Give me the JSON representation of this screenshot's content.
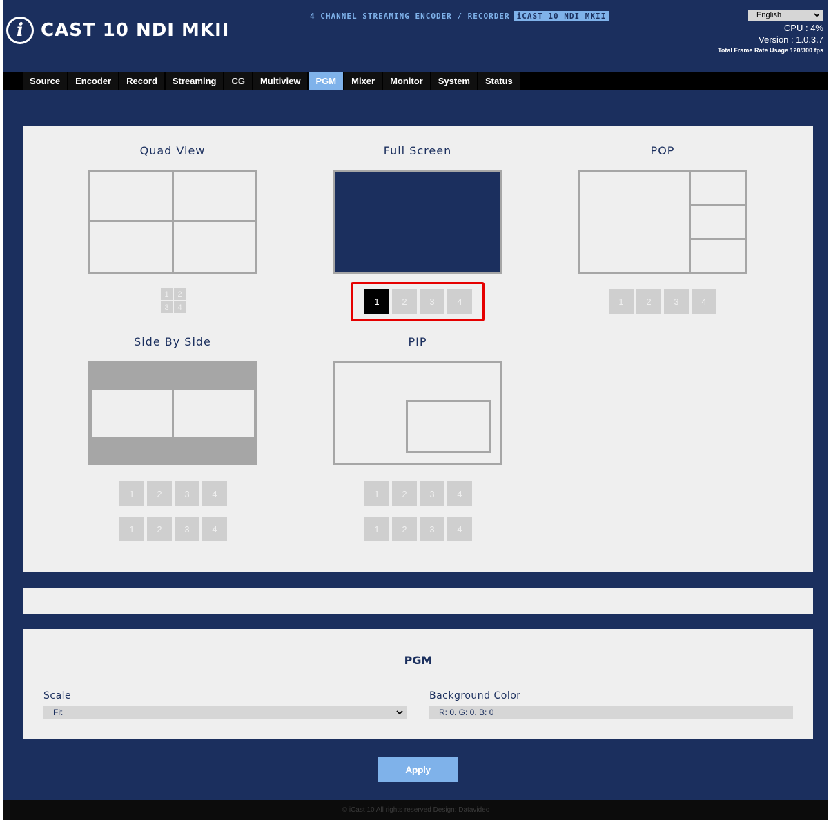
{
  "header": {
    "logo_letter": "i",
    "logo_text": "CAST 10 NDI MKII",
    "subtitle": "4 CHANNEL STREAMING ENCODER / RECORDER",
    "badge": "iCAST 10 NDI MKII",
    "language": "English",
    "cpu": "CPU : 4%",
    "version": "Version : 1.0.3.7",
    "frame_rate": "Total Frame Rate Usage 120/300 fps"
  },
  "nav": {
    "items": [
      "Source",
      "Encoder",
      "Record",
      "Streaming",
      "CG",
      "Multiview",
      "PGM",
      "Mixer",
      "Monitor",
      "System",
      "Status"
    ],
    "active": "PGM"
  },
  "layouts": {
    "quad_view": {
      "title": "Quad View",
      "mini": [
        "1",
        "2",
        "3",
        "4"
      ]
    },
    "full_screen": {
      "title": "Full Screen",
      "buttons": [
        "1",
        "2",
        "3",
        "4"
      ],
      "selected": "1"
    },
    "pop": {
      "title": "POP",
      "buttons": [
        "1",
        "2",
        "3",
        "4"
      ]
    },
    "side_by_side": {
      "title": "Side By Side",
      "row1": [
        "1",
        "2",
        "3",
        "4"
      ],
      "row2": [
        "1",
        "2",
        "3",
        "4"
      ]
    },
    "pip": {
      "title": "PIP",
      "row1": [
        "1",
        "2",
        "3",
        "4"
      ],
      "row2": [
        "1",
        "2",
        "3",
        "4"
      ]
    }
  },
  "pgm": {
    "title": "PGM",
    "scale_label": "Scale",
    "scale_value": "Fit",
    "bg_label": "Background Color",
    "bg_value": "R: 0. G: 0. B: 0"
  },
  "apply_label": "Apply",
  "footer": "© iCast 10 All rights reserved Design: Datavideo",
  "colors": {
    "primary": "#1b2f5e",
    "accent": "#7fb2ea",
    "highlight": "#e50000"
  }
}
